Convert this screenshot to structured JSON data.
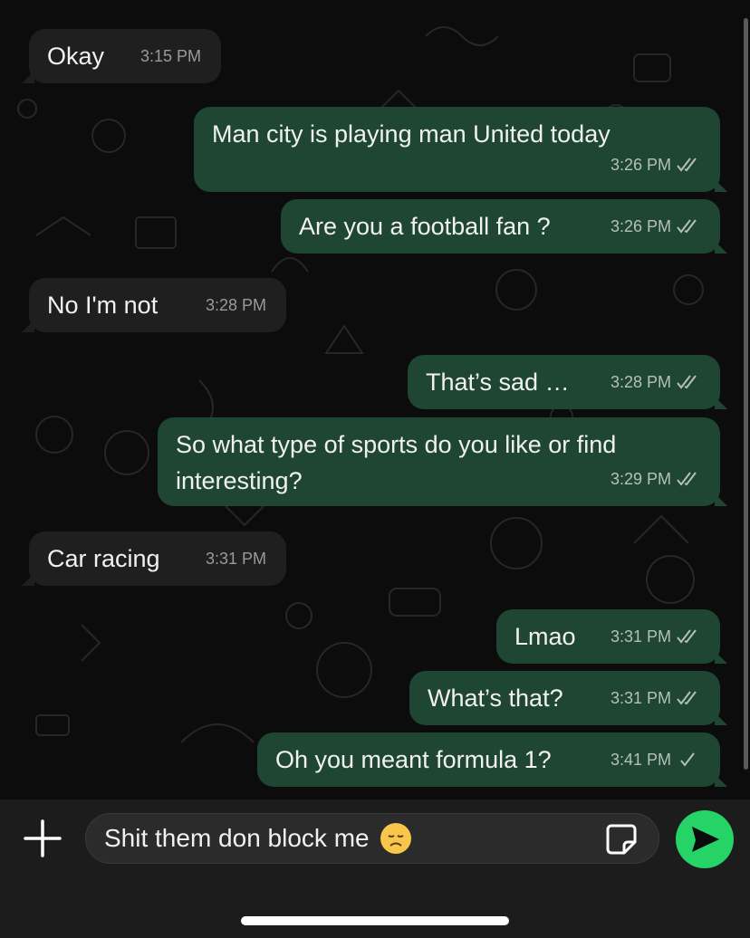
{
  "messages": [
    {
      "text": "Okay",
      "time": "3:15 PM",
      "dir": "in"
    },
    {
      "text": "Man city is playing man United today",
      "time": "3:26 PM",
      "dir": "out",
      "ticks": "double"
    },
    {
      "text": "Are you a football fan ?",
      "time": "3:26 PM",
      "dir": "out",
      "ticks": "double"
    },
    {
      "text": "No I'm not",
      "time": "3:28 PM",
      "dir": "in"
    },
    {
      "text": "That’s sad …",
      "time": "3:28 PM",
      "dir": "out",
      "ticks": "double"
    },
    {
      "text": "So what type of sports do you like or find interesting?",
      "time": "3:29 PM",
      "dir": "out",
      "ticks": "double"
    },
    {
      "text": "Car racing",
      "time": "3:31 PM",
      "dir": "in"
    },
    {
      "text": "Lmao",
      "time": "3:31 PM",
      "dir": "out",
      "ticks": "double"
    },
    {
      "text": "What’s that?",
      "time": "3:31 PM",
      "dir": "out",
      "ticks": "double"
    },
    {
      "text": "Oh you meant formula 1?",
      "time": "3:41 PM",
      "dir": "out",
      "ticks": "single"
    }
  ],
  "composer": {
    "input_value": "Shit them don block me",
    "input_emoji": "disappointed-face",
    "attach_icon": "plus-icon",
    "sticker_icon": "sticker-icon",
    "send_icon": "send-icon"
  },
  "colors": {
    "outgoing_bubble": "#1e4632",
    "incoming_bubble": "#1f1f20",
    "send_button": "#25d366"
  }
}
